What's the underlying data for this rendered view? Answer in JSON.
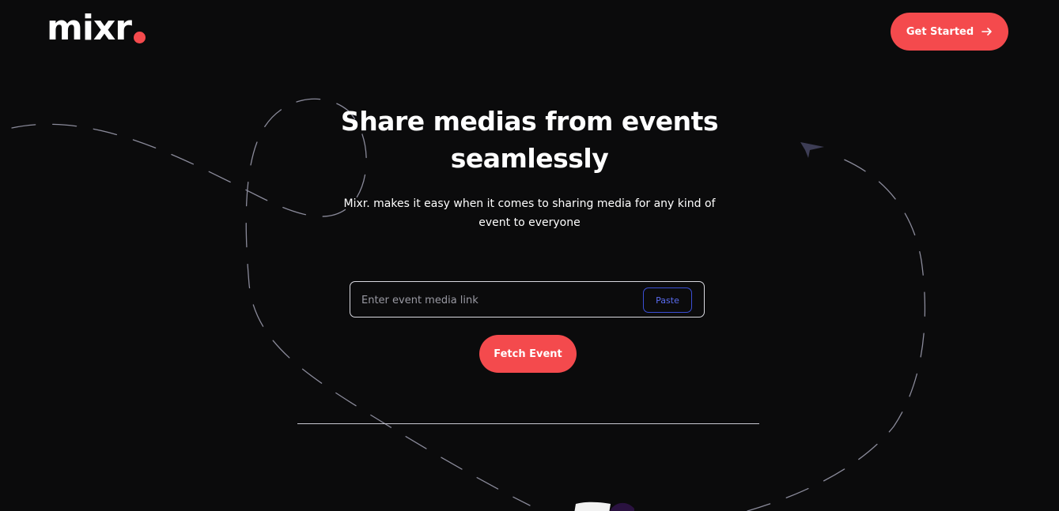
{
  "brand": {
    "name": "mixr",
    "accent_color": "#f44a4d"
  },
  "header": {
    "cta_label": "Get Started",
    "cta_icon": "arrow-right-icon"
  },
  "hero": {
    "title_line1": "Share medias from events",
    "title_line2": "seamlessly",
    "subtitle_line1": "Mixr. makes it easy when it comes to sharing media for any kind of",
    "subtitle_line2": "event to everyone"
  },
  "link_form": {
    "placeholder": "Enter event media link",
    "value": "",
    "paste_label": "Paste",
    "paste_color": "#3b4fd6",
    "submit_label": "Fetch Event"
  },
  "decor": {
    "path_color": "#8a8a9a",
    "plane_icon": "paper-plane-icon",
    "plane_color": "#3d3d55"
  }
}
